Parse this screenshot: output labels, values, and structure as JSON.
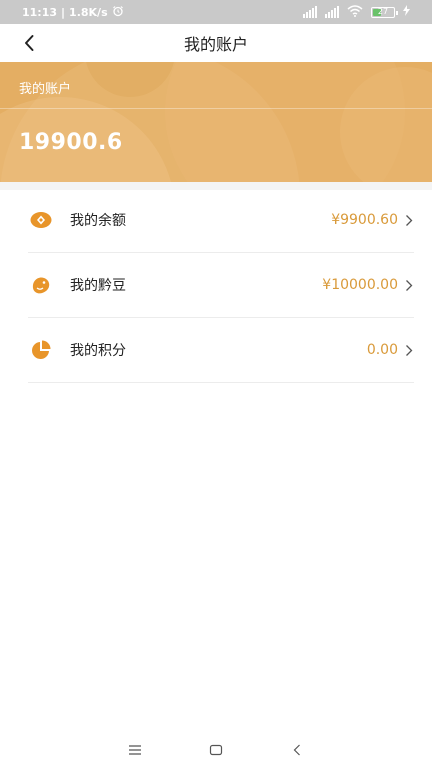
{
  "status_bar": {
    "time": "11:13",
    "speed": "1.8K/s",
    "battery_level": "27"
  },
  "header": {
    "title": "我的账户"
  },
  "banner": {
    "label": "我的账户",
    "total": "19900.6"
  },
  "accounts": [
    {
      "label": "我的余额",
      "value": "¥9900.60",
      "icon": "balance-icon"
    },
    {
      "label": "我的黔豆",
      "value": "¥10000.00",
      "icon": "bean-icon"
    },
    {
      "label": "我的积分",
      "value": "0.00",
      "icon": "points-icon"
    }
  ],
  "colors": {
    "accent": "#e4ae63",
    "value_text": "#d99a3a",
    "icon": "#e8952a"
  }
}
